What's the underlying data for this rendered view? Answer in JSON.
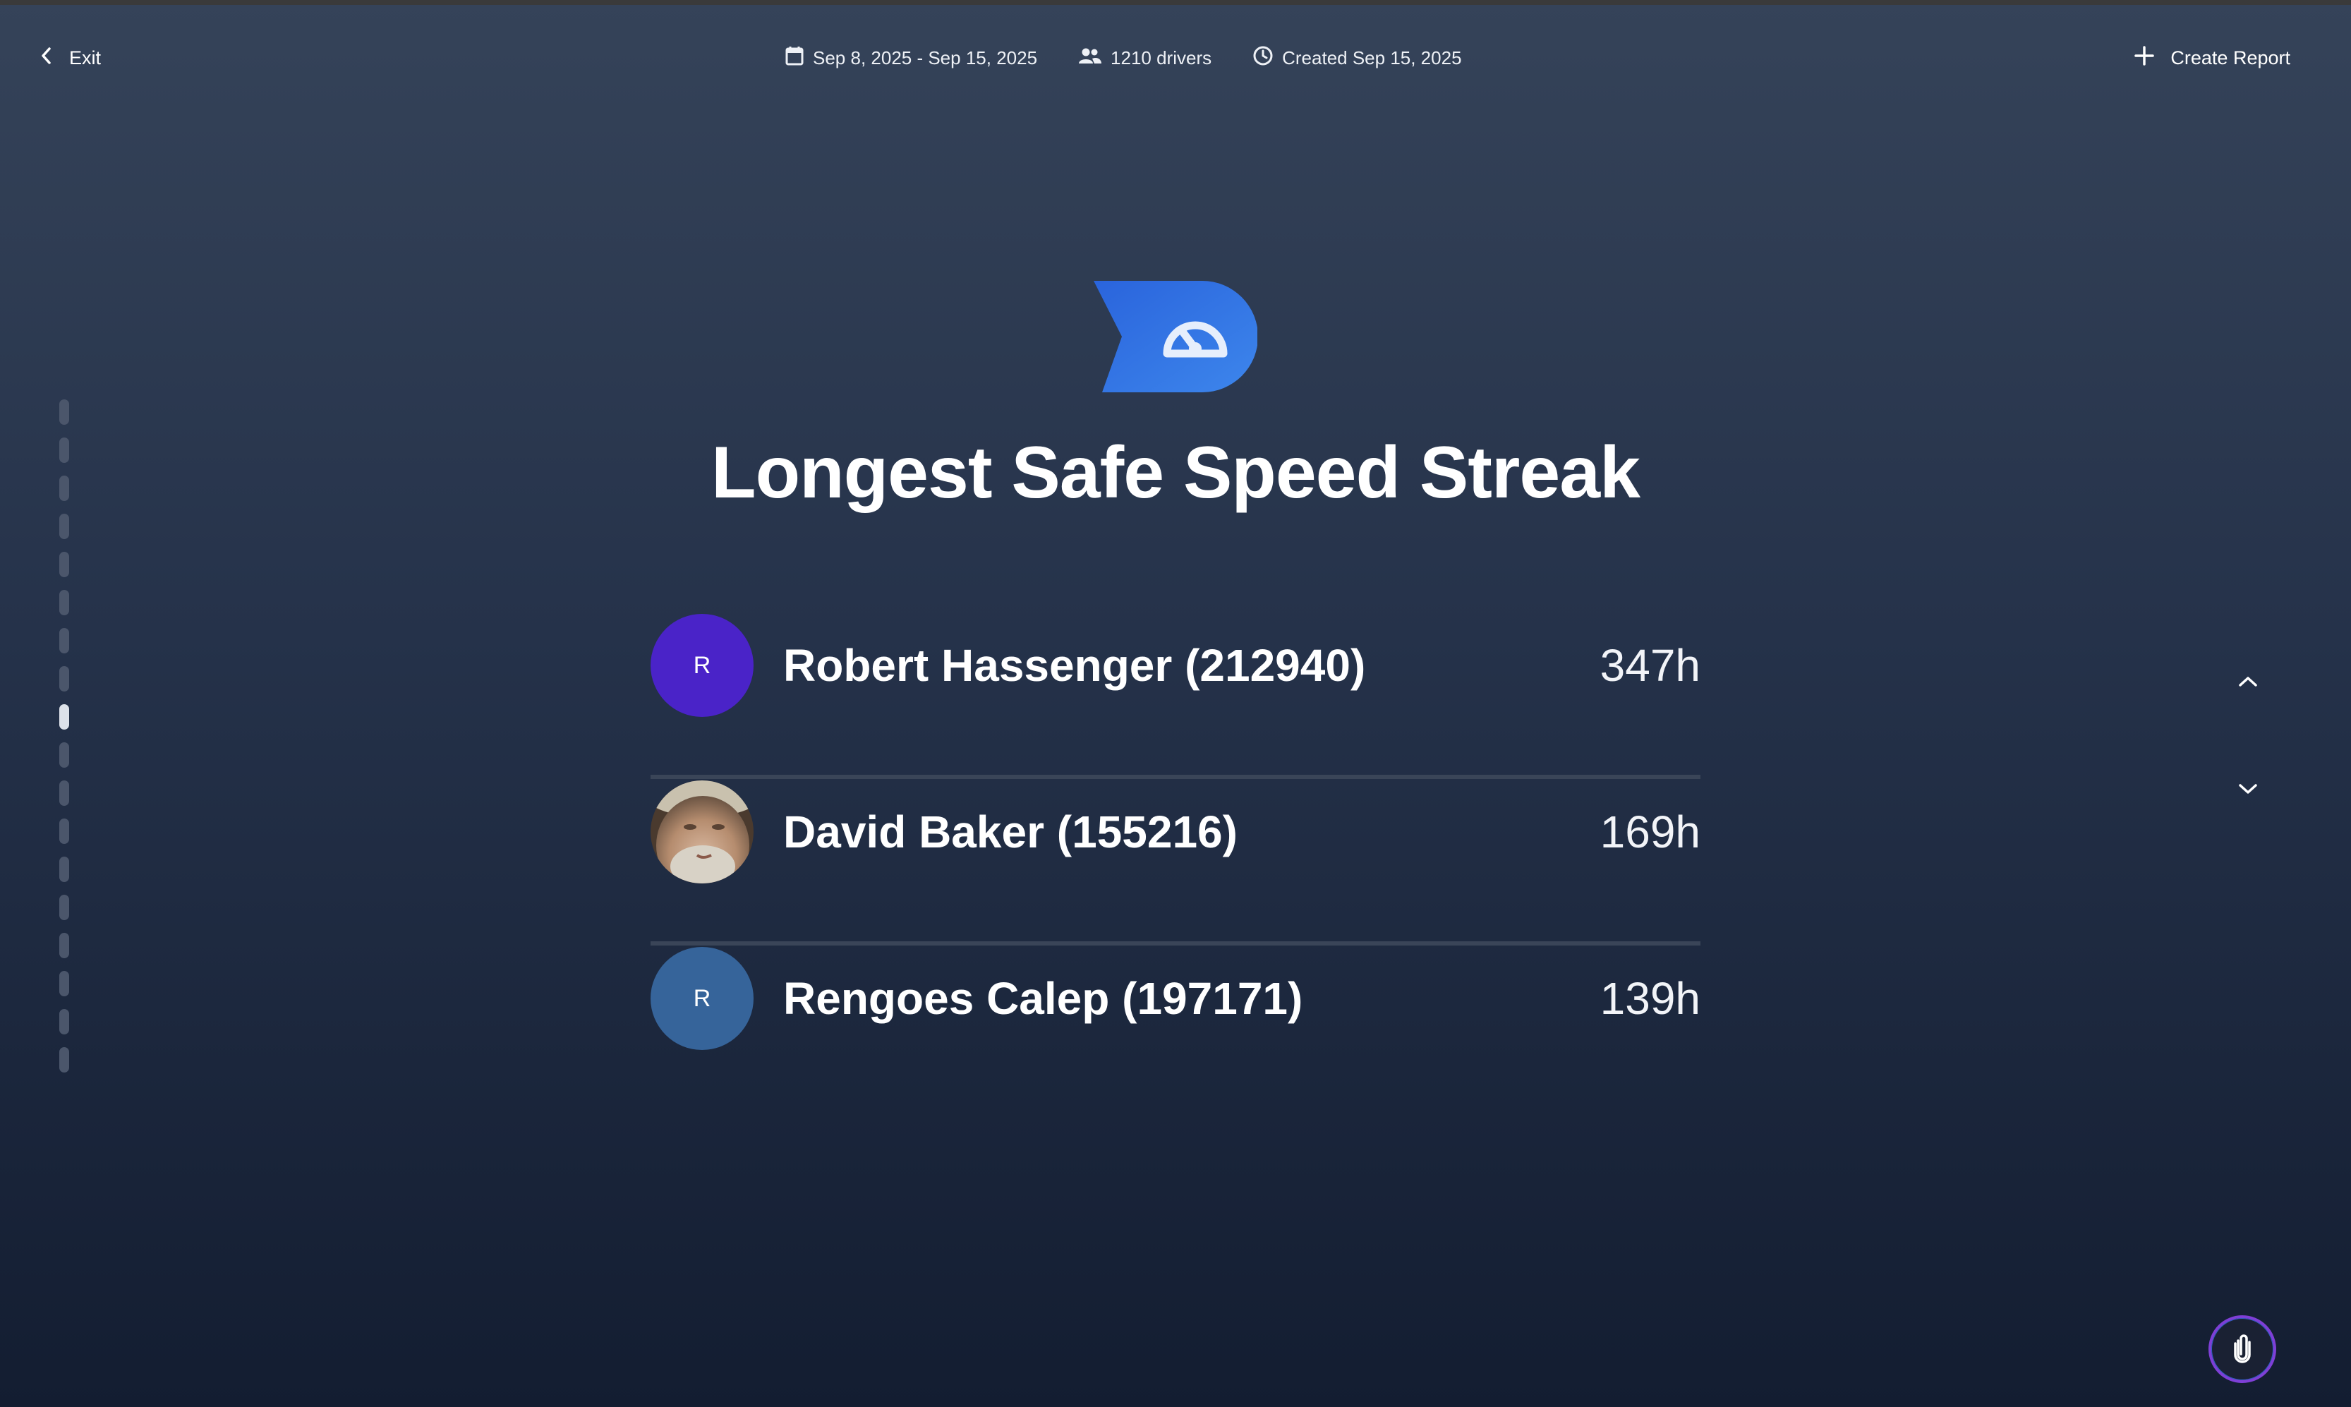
{
  "header": {
    "exit_label": "Exit",
    "date_range": "Sep 8, 2025 - Sep 15, 2025",
    "drivers": "1210 drivers",
    "created": "Created Sep 15, 2025",
    "create_report_label": "Create Report"
  },
  "main": {
    "icon": "speedometer-icon",
    "title": "Longest Safe Speed Streak",
    "leaderboard": [
      {
        "name": "Robert Hassenger (212940)",
        "value": "347h",
        "avatar_initial": "R",
        "avatar_color": "#4a23c8"
      },
      {
        "name": "David Baker (155216)",
        "value": "169h",
        "avatar_photo": true
      },
      {
        "name": "Rengoes Calep (197171)",
        "value": "139h",
        "avatar_initial": "R",
        "avatar_color": "#36649a"
      }
    ]
  },
  "navigation": {
    "prev_icon": "chevron-up-icon",
    "next_icon": "chevron-down-icon",
    "progress_total": 18,
    "progress_current": 9
  },
  "colors": {
    "accent_blue": "#2f6de0",
    "background_top": "#354359",
    "background_bottom": "#131d31"
  }
}
